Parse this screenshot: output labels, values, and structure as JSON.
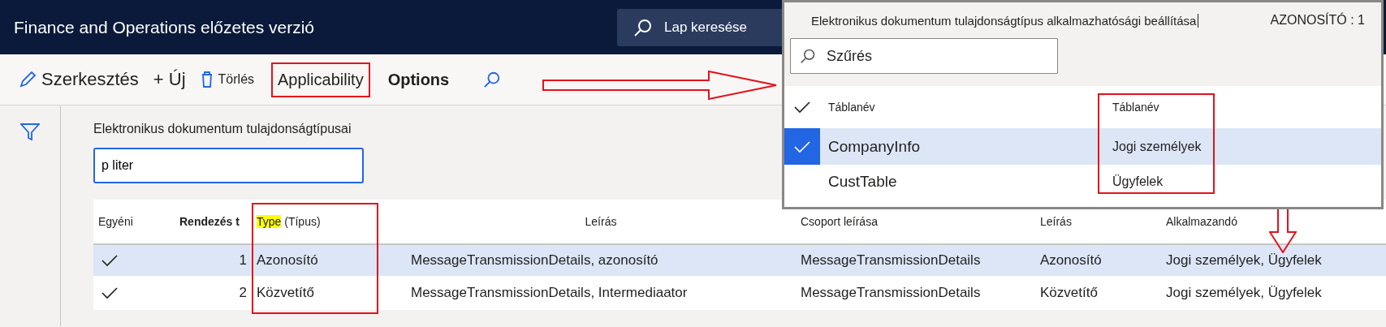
{
  "header": {
    "title": "Finance and Operations előzetes verzió",
    "search_placeholder": "Lap keresése"
  },
  "toolbar": {
    "items": [
      {
        "kind": "edit",
        "label": "Szerkesztés"
      },
      {
        "kind": "new",
        "label": "+ Új"
      },
      {
        "kind": "delete",
        "label": "Törlés"
      },
      {
        "kind": "tab",
        "label": "Applicability",
        "selected": false,
        "annotated": true
      },
      {
        "kind": "tab",
        "label": "Options",
        "selected": true,
        "annotated": false
      },
      {
        "kind": "search"
      }
    ]
  },
  "filter": {
    "label": "Elektronikus dokumentum tulajdonságtípusai",
    "value": "p liter"
  },
  "table": {
    "columns": [
      {
        "parts": [
          {
            "text": "Egyéni",
            "highlighted": false
          }
        ],
        "annotated": false
      },
      {
        "parts": [
          {
            "text": "Rendezés t",
            "highlighted": false
          }
        ],
        "annotated": false
      },
      {
        "parts": [
          {
            "text": "Type",
            "highlighted": true
          },
          {
            "text": " (Típus)",
            "highlighted": false
          }
        ],
        "annotated": true
      },
      {
        "parts": [
          {
            "text": "Leírás",
            "highlighted": false
          }
        ],
        "annotated": false
      },
      {
        "parts": [
          {
            "text": "Csoport leírása",
            "highlighted": false
          }
        ],
        "annotated": false
      },
      {
        "parts": [
          {
            "text": "Leírás",
            "highlighted": false
          }
        ],
        "annotated": false
      },
      {
        "parts": [
          {
            "text": "Alkalmazandó",
            "highlighted": false
          }
        ],
        "annotated": false
      }
    ],
    "rows": [
      {
        "selected": true,
        "cells": [
          {
            "kind": "check",
            "checked": true
          },
          {
            "kind": "text",
            "text": "1"
          },
          {
            "kind": "text",
            "text": "Azonosító"
          },
          {
            "kind": "text",
            "text": "MessageTransmissionDetails, azonosító"
          },
          {
            "kind": "text",
            "text": "MessageTransmissionDetails"
          },
          {
            "kind": "text",
            "text": "Azonosító"
          },
          {
            "kind": "text",
            "text": "Jogi személyek, Ügyfelek"
          }
        ]
      },
      {
        "selected": false,
        "cells": [
          {
            "kind": "check",
            "checked": true
          },
          {
            "kind": "text",
            "text": "2"
          },
          {
            "kind": "text",
            "text": "Közvetítő"
          },
          {
            "kind": "text",
            "text": "MessageTransmissionDetails, Intermediaator"
          },
          {
            "kind": "text",
            "text": "MessageTransmissionDetails"
          },
          {
            "kind": "text",
            "text": "Közvetítő"
          },
          {
            "kind": "text",
            "text": "Jogi személyek, Ügyfelek"
          }
        ]
      }
    ]
  },
  "popup": {
    "title": "Elektronikus dokumentum tulajdonságtípus alkalmazhatósági beállítása",
    "id_label": "AZONOSÍTÓ : 1",
    "search_placeholder": "Szűrés",
    "columns": [
      {
        "label": "Táblanév",
        "annotated": false
      },
      {
        "label": "Táblanév",
        "annotated": true
      }
    ],
    "rows": [
      {
        "selected": true,
        "cells": [
          "CompanyInfo",
          "Jogi személyek"
        ]
      },
      {
        "selected": false,
        "cells": [
          "CustTable",
          "Ügyfelek"
        ]
      }
    ]
  }
}
